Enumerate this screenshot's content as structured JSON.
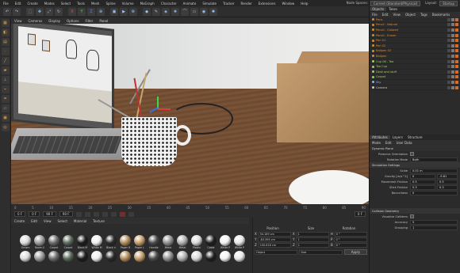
{
  "menubar": {
    "items": [
      "File",
      "Edit",
      "Create",
      "Modes",
      "Select",
      "Tools",
      "Mesh",
      "Spline",
      "Volume",
      "MoGraph",
      "Character",
      "Animate",
      "Simulate",
      "Tracker",
      "Render",
      "Extensions",
      "Window",
      "Help"
    ],
    "node_spaces_label": "Node Spaces:",
    "node_spaces_value": "Current (Standard/Physical)",
    "layout_label": "Layout:",
    "layout_value": "Startup"
  },
  "viewport_menu": [
    "View",
    "Cameras",
    "Display",
    "Options",
    "Filter",
    "Panel"
  ],
  "timeline": {
    "ruler": [
      "0",
      "5",
      "10",
      "15",
      "20",
      "25",
      "30",
      "35",
      "40",
      "45",
      "50",
      "55",
      "60",
      "65",
      "70",
      "75",
      "80",
      "85",
      "90"
    ],
    "current_frame": "0 F",
    "start_frame": "0 F",
    "end_frame": "90 F",
    "end_frame2": "90 F",
    "right_frame": "0 F"
  },
  "material_panel": {
    "menu": [
      "Create",
      "Edit",
      "View",
      "Select",
      "Material",
      "Texture"
    ],
    "materials": [
      {
        "label": "Ornam",
        "color": "#dcdcdc"
      },
      {
        "label": "Room.0",
        "color": "#9a9a9a"
      },
      {
        "label": "Carpet",
        "color": "#6b6b6b"
      },
      {
        "label": "Carpet",
        "color": "#5a6a5a"
      },
      {
        "label": "Black M",
        "color": "#1d1d1d"
      },
      {
        "label": "White M",
        "color": "#efefef"
      },
      {
        "label": "Black n",
        "color": "#2b2b2b"
      },
      {
        "label": "Paper R",
        "color": "#b08a5a"
      },
      {
        "label": "Paper L",
        "color": "#c49d6b"
      },
      {
        "label": "Handle",
        "color": "#4a4a4a"
      },
      {
        "label": "Metal",
        "color": "#8f8f8f"
      },
      {
        "label": "Metal",
        "color": "#b0b0b0"
      },
      {
        "label": "Plastic",
        "color": "#d9d9d9"
      },
      {
        "label": "Cable",
        "color": "#202020"
      },
      {
        "label": "White P",
        "color": "#f2f2f2"
      },
      {
        "label": "White P",
        "color": "#e6e6e6"
      }
    ]
  },
  "coords": {
    "headers": [
      "Position",
      "Size",
      "Rotation"
    ],
    "rows": [
      {
        "axis": "X",
        "pos": "54.189 cm",
        "size_axis": "X",
        "size": "1",
        "rot_axis": "H",
        "rot": "0 °"
      },
      {
        "axis": "Y",
        "pos": "-83.393 cm",
        "size_axis": "Y",
        "size": "1",
        "rot_axis": "P",
        "rot": "0 °"
      },
      {
        "axis": "Z",
        "pos": "100.618 cm",
        "size_axis": "Z",
        "size": "1",
        "rot_axis": "B",
        "rot": "0 °"
      }
    ],
    "mode_left": "Object",
    "mode_mid": "Size",
    "apply": "Apply"
  },
  "right_panel": {
    "tabs": [
      "Objects",
      "Takes"
    ],
    "menu": [
      "File",
      "Edit",
      "View",
      "Object",
      "Tags",
      "Bookmarks"
    ],
    "objects": [
      {
        "name": "Pens",
        "color": "#e08a2b"
      },
      {
        "name": "Pencil - Natural",
        "color": "#e08a2b"
      },
      {
        "name": "Pencil - Colored",
        "color": "#e08a2b"
      },
      {
        "name": "Pencil - Eraser",
        "color": "#e08a2b"
      },
      {
        "name": "Pen 01",
        "color": "#e08a2b"
      },
      {
        "name": "Pen 02",
        "color": "#e08a2b"
      },
      {
        "name": "Ballpen 02",
        "color": "#e08a2b"
      },
      {
        "name": "Ballpen",
        "color": "#e08a2b"
      },
      {
        "name": "Cup 06 - Tea",
        "color": "#9cd15e"
      },
      {
        "name": "Tea Cup",
        "color": "#9cd15e"
      },
      {
        "name": "Desk and stuff",
        "color": "#9cd15e"
      },
      {
        "name": "Carpet",
        "color": "#9cd15e"
      },
      {
        "name": "Sky",
        "color": "#7fb8e0"
      },
      {
        "name": "Camera",
        "color": "#c8c8c8"
      }
    ],
    "attr_tabs": [
      "Attributes",
      "Layers",
      "Structure"
    ],
    "attr_menu": [
      "Mode",
      "Edit",
      "User Data"
    ],
    "tag_title": "Dynamic Plane",
    "preserve_label": "Preserve Orientation",
    "rotation_mode_label": "Rotation Mode",
    "rotation_mode_value": "Both",
    "sim_section": "Simulation Settings",
    "sim_rows": [
      {
        "label": "Scale",
        "value": "0.01 m"
      },
      {
        "label": "Gravity [m/s^2]",
        "value": "0"
      },
      {
        "label": "Movement Friction",
        "value": "0.5"
      },
      {
        "label": "Stick Friction",
        "value": "0.3"
      },
      {
        "label": "Bounciness",
        "value": "0"
      }
    ],
    "collision_section": "Collision Geometry",
    "coll_rows": [
      {
        "label": "Visualize Colliders",
        "value": ""
      },
      {
        "label": "Accuracy",
        "value": "5"
      },
      {
        "label": "Grouping",
        "value": "1"
      }
    ],
    "side_values": [
      "-9.81",
      "0.5",
      "0.3"
    ]
  }
}
